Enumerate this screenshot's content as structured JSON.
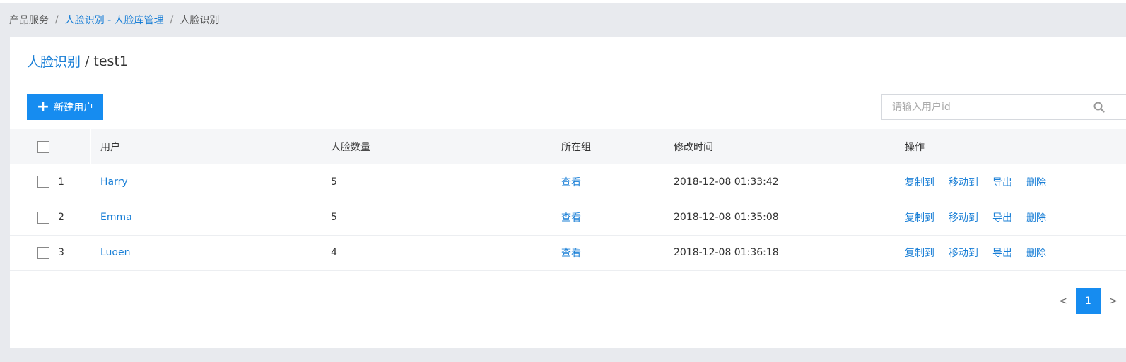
{
  "breadcrumb": {
    "root": "产品服务",
    "parent": "人脸识别 - 人脸库管理",
    "current": "人脸识别"
  },
  "header": {
    "parent_link": "人脸识别",
    "current": "test1"
  },
  "toolbar": {
    "new_user_label": "新建用户",
    "search_placeholder": "请输入用户id"
  },
  "table": {
    "columns": [
      "用户",
      "人脸数量",
      "所在组",
      "修改时间",
      "操作"
    ],
    "rows": [
      {
        "index": "1",
        "user": "Harry",
        "faces": "5",
        "group": "查看",
        "modified": "2018-12-08 01:33:42"
      },
      {
        "index": "2",
        "user": "Emma",
        "faces": "5",
        "group": "查看",
        "modified": "2018-12-08 01:35:08"
      },
      {
        "index": "3",
        "user": "Luoen",
        "faces": "4",
        "group": "查看",
        "modified": "2018-12-08 01:36:18"
      }
    ],
    "actions": [
      "复制到",
      "移动到",
      "导出",
      "删除"
    ]
  },
  "pagination": {
    "prev": "<",
    "current_page": "1",
    "next": ">"
  },
  "colors": {
    "primary": "#168cf0",
    "link": "#1a7fd6",
    "background": "#e8eaee"
  }
}
